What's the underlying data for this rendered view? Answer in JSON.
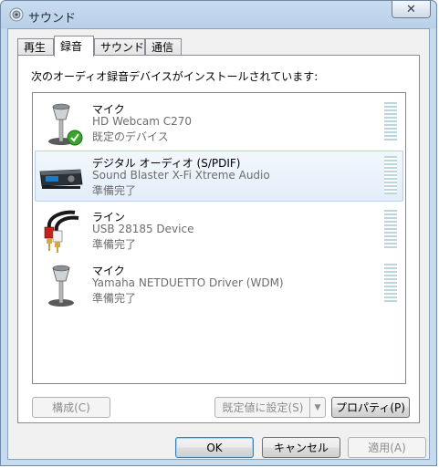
{
  "window": {
    "title": "サウンド",
    "close_glyph": "✕"
  },
  "tabs": [
    {
      "label": "再生",
      "active": false
    },
    {
      "label": "録音",
      "active": true
    },
    {
      "label": "サウンド",
      "active": false
    },
    {
      "label": "通信",
      "active": false
    }
  ],
  "panel": {
    "intro": "次のオーディオ録音デバイスがインストールされています:"
  },
  "devices": [
    {
      "name": "マイク",
      "description": "HD Webcam C270",
      "status": "既定のデバイス",
      "icon": "microphone-icon",
      "default": true,
      "selected": false
    },
    {
      "name": "デジタル オーディオ (S/PDIF)",
      "description": "Sound Blaster X-Fi Xtreme Audio",
      "status": "準備完了",
      "icon": "digital-audio-device-icon",
      "default": false,
      "selected": true
    },
    {
      "name": "ライン",
      "description": "USB 28185 Device",
      "status": "準備完了",
      "icon": "rca-cable-icon",
      "default": false,
      "selected": false
    },
    {
      "name": "マイク",
      "description": "Yamaha NETDUETTO Driver (WDM)",
      "status": "準備完了",
      "icon": "microphone-icon",
      "default": false,
      "selected": false
    }
  ],
  "panel_buttons": {
    "configure": "構成(C)",
    "set_default": "既定値に設定(S)",
    "split_arrow": "▼",
    "properties": "プロパティ(P)"
  },
  "dialog_buttons": {
    "ok": "OK",
    "cancel": "キャンセル",
    "apply": "適用(A)"
  },
  "colors": {
    "selection": "#e3eefa",
    "meter": "#bcd6de",
    "default_check": "#3aa52e"
  }
}
